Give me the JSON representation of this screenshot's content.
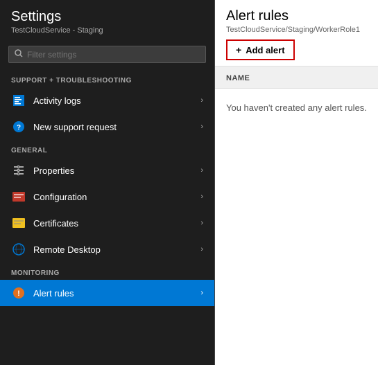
{
  "left_panel": {
    "title": "Settings",
    "subtitle": "TestCloudService - Staging",
    "search_placeholder": "Filter settings",
    "sections": [
      {
        "label": "SUPPORT + TROUBLESHOOTING",
        "items": [
          {
            "id": "activity-logs",
            "label": "Activity logs",
            "active": false
          },
          {
            "id": "new-support-request",
            "label": "New support request",
            "active": false
          }
        ]
      },
      {
        "label": "GENERAL",
        "items": [
          {
            "id": "properties",
            "label": "Properties",
            "active": false
          },
          {
            "id": "configuration",
            "label": "Configuration",
            "active": false
          },
          {
            "id": "certificates",
            "label": "Certificates",
            "active": false
          },
          {
            "id": "remote-desktop",
            "label": "Remote Desktop",
            "active": false
          }
        ]
      },
      {
        "label": "MONITORING",
        "items": [
          {
            "id": "alert-rules",
            "label": "Alert rules",
            "active": true
          }
        ]
      }
    ]
  },
  "right_panel": {
    "title": "Alert rules",
    "subtitle": "TestCloudService/Staging/WorkerRole1",
    "add_alert_label": "Add alert",
    "column_name": "NAME",
    "empty_message": "You haven't created any alert rules."
  }
}
